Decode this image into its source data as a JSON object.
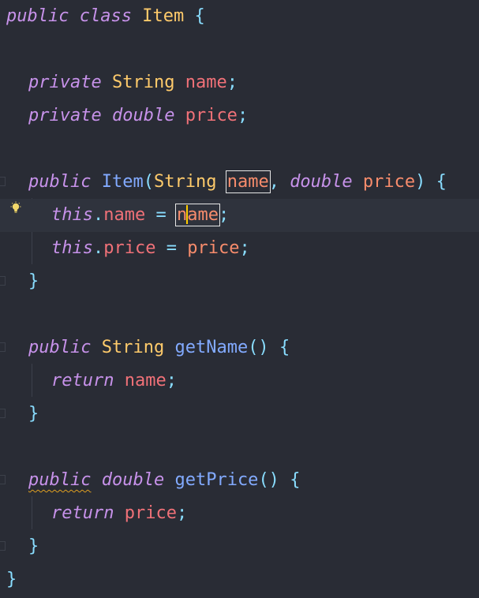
{
  "editor": {
    "language": "Java",
    "theme": {
      "background": "#292c35",
      "current_line": "#2f333d",
      "keyword": "#c792ea",
      "type": "#ffcb6b",
      "field": "#f07178",
      "parameter": "#f78c6c",
      "function": "#82aaff",
      "punctuation": "#89ddff"
    },
    "lines": {
      "l1": {
        "kw1": "public",
        "kw2": "class",
        "name": "Item",
        "brace": "{"
      },
      "l3": {
        "kw": "private",
        "type": "String",
        "field": "name",
        "semi": ";"
      },
      "l4": {
        "kw": "private",
        "type": "double",
        "field": "price",
        "semi": ";"
      },
      "l6": {
        "kw": "public",
        "ctor": "Item",
        "lparen": "(",
        "t1": "String",
        "p1": "name",
        "comma": ",",
        "t2": "double",
        "p2": "price",
        "rparen": ")",
        "brace": "{"
      },
      "l7": {
        "this": "this",
        "dot": ".",
        "field": "name",
        "eq": "=",
        "val_a": "n",
        "val_b": "ame",
        "semi": ";"
      },
      "l8": {
        "this": "this",
        "dot": ".",
        "field": "price",
        "eq": "=",
        "val": "price",
        "semi": ";"
      },
      "l9": {
        "brace": "}"
      },
      "l11": {
        "kw": "public",
        "type": "String",
        "fn": "getName",
        "parens": "()",
        "brace": "{"
      },
      "l12": {
        "kw": "return",
        "field": "name",
        "semi": ";"
      },
      "l13": {
        "brace": "}"
      },
      "l15": {
        "kw": "public",
        "type": "double",
        "fn": "getPrice",
        "parens": "()",
        "brace": "{"
      },
      "l16": {
        "kw": "return",
        "field": "price",
        "semi": ";"
      },
      "l17": {
        "brace": "}"
      },
      "l18": {
        "brace": "}"
      }
    },
    "gutter": {
      "intention_icon": "lightbulb-icon"
    }
  }
}
